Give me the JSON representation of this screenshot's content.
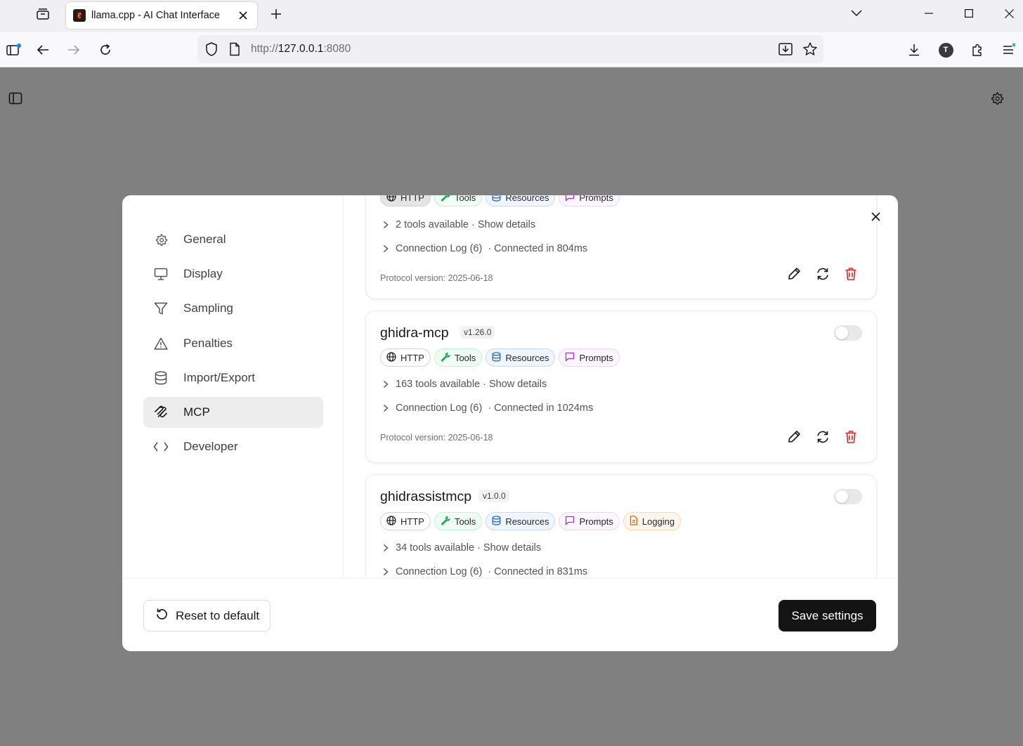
{
  "browser": {
    "tab_title": "llama.cpp - AI Chat Interface",
    "url_scheme": "http://",
    "url_host": "127.0.0.1",
    "url_port": ":8080"
  },
  "settings": {
    "nav": [
      {
        "label": "General",
        "icon": "gear-icon"
      },
      {
        "label": "Display",
        "icon": "monitor-icon"
      },
      {
        "label": "Sampling",
        "icon": "filter-icon"
      },
      {
        "label": "Penalties",
        "icon": "warning-icon"
      },
      {
        "label": "Import/Export",
        "icon": "database-icon"
      },
      {
        "label": "MCP",
        "icon": "mcp-icon",
        "active": true
      },
      {
        "label": "Developer",
        "icon": "code-icon"
      }
    ],
    "badge_labels": {
      "http": "HTTP",
      "tools": "Tools",
      "resources": "Resources",
      "prompts": "Prompts",
      "logging": "Logging"
    },
    "servers": [
      {
        "tools_text": "2 tools available · Show details",
        "log_text": "Connection Log (6)",
        "connected_text": "· Connected in 804ms",
        "protocol": "Protocol version: 2025-06-18"
      },
      {
        "name": "ghidra-mcp",
        "version": "v1.26.0",
        "enabled": false,
        "tools_text": "163 tools available · Show details",
        "log_text": "Connection Log (6)",
        "connected_text": "· Connected in 1024ms",
        "protocol": "Protocol version: 2025-06-18"
      },
      {
        "name": "ghidrassistmcp",
        "version": "v1.0.0",
        "enabled": false,
        "tools_text": "34 tools available · Show details",
        "log_text": "Connection Log (6)",
        "connected_text": "· Connected in 831ms"
      }
    ],
    "reset_label": "Reset to default",
    "save_label": "Save settings"
  },
  "colors": {
    "accent_dark": "#141414",
    "delete_red": "#dc2626",
    "tools_green": "#16a34a",
    "resources_blue": "#2563eb",
    "prompts_purple": "#9333ea",
    "logging_orange": "#ea580c"
  }
}
